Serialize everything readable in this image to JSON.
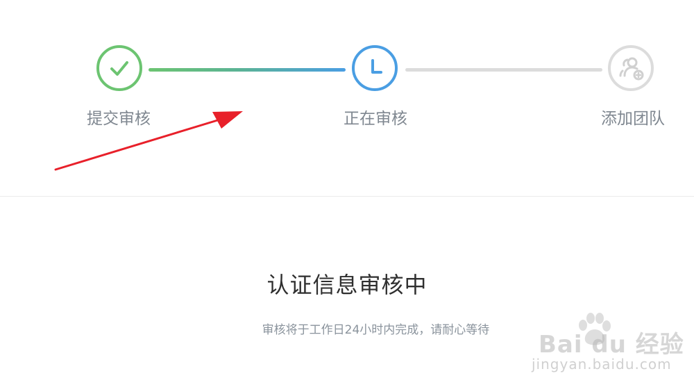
{
  "steps": [
    {
      "label": "提交审核",
      "state": "completed",
      "icon": "check-icon",
      "color": "#6cc471"
    },
    {
      "label": "正在审核",
      "state": "current",
      "icon": "clock-icon",
      "color": "#4a9ee3"
    },
    {
      "label": "添加团队",
      "state": "pending",
      "icon": "add-team-icon",
      "color": "#d0d0d0"
    }
  ],
  "status": {
    "title": "认证信息审核中",
    "subtitle": "审核将于工作日24小时内完成，请耐心等待"
  },
  "annotation": {
    "icon": "red-arrow-icon",
    "color": "#e8202a"
  },
  "watermark": {
    "brand": "Bai du 经验",
    "url": "jingyan.baidu.com"
  }
}
